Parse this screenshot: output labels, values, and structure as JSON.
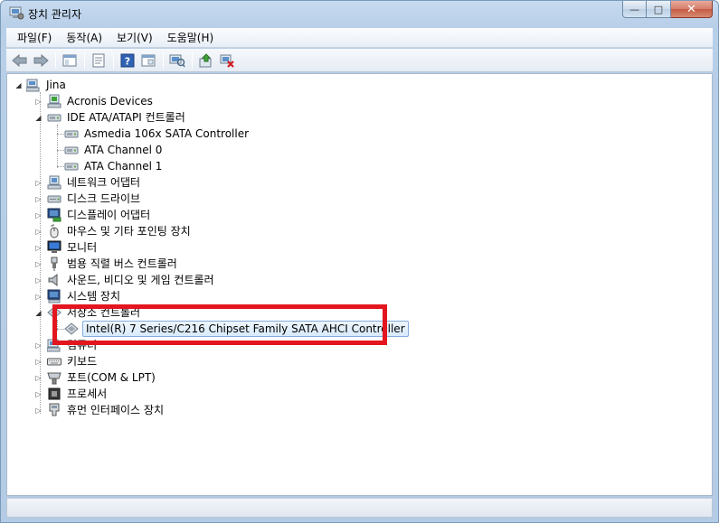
{
  "window": {
    "title": "장치 관리자",
    "caption": {
      "minimize": "—",
      "maximize": "□",
      "close": "✕"
    }
  },
  "menu": [
    "파일(F)",
    "동작(A)",
    "보기(V)",
    "도움말(H)"
  ],
  "toolbar": {
    "icons": [
      "back-icon",
      "forward-icon",
      "show-hide-tree-icon",
      "properties-icon",
      "help-icon",
      "view-icon",
      "scan-hardware-icon",
      "update-driver-icon",
      "uninstall-icon"
    ]
  },
  "tree": {
    "root": "Jina",
    "items": [
      {
        "label": "Acronis Devices",
        "expanded": false
      },
      {
        "label": "IDE ATA/ATAPI 컨트롤러",
        "expanded": true,
        "children": [
          "Asmedia 106x SATA Controller",
          "ATA Channel 0",
          "ATA Channel 1"
        ]
      },
      {
        "label": "네트워크 어댑터",
        "expanded": false
      },
      {
        "label": "디스크 드라이브",
        "expanded": false
      },
      {
        "label": "디스플레이 어댑터",
        "expanded": false
      },
      {
        "label": "마우스 및 기타 포인팅 장치",
        "expanded": false
      },
      {
        "label": "모니터",
        "expanded": false
      },
      {
        "label": "범용 직렬 버스 컨트롤러",
        "expanded": false
      },
      {
        "label": "사운드, 비디오 및 게임 컨트롤러",
        "expanded": false
      },
      {
        "label": "시스템 장치",
        "expanded": false
      },
      {
        "label": "저장소 컨트롤러",
        "expanded": true,
        "children": [
          "Intel(R) 7 Series/C216 Chipset Family SATA AHCI Controller"
        ]
      },
      {
        "label": "컴퓨터",
        "expanded": false
      },
      {
        "label": "키보드",
        "expanded": false
      },
      {
        "label": "포트(COM & LPT)",
        "expanded": false
      },
      {
        "label": "프로세서",
        "expanded": false
      },
      {
        "label": "휴먼 인터페이스 장치",
        "expanded": false
      }
    ]
  },
  "highlight_color": "#e3161f"
}
